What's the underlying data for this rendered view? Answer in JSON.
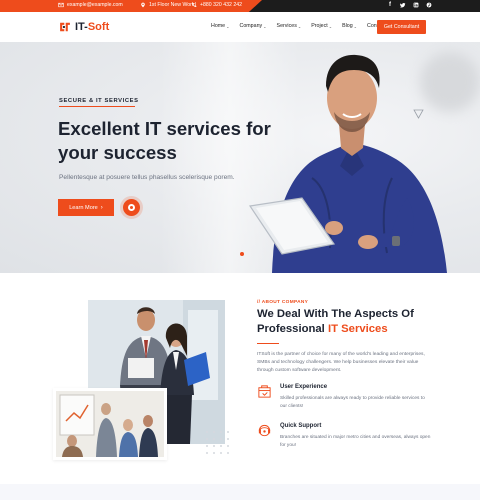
{
  "topbar": {
    "email": "example@example.com",
    "address": "1st Floor New World",
    "phone": "+880 320 432 242",
    "social_icons": [
      "facebook-icon",
      "twitter-icon",
      "linkedin-icon",
      "pinterest-icon"
    ]
  },
  "brand": {
    "name_prefix": "IT-",
    "name_suffix": "Soft"
  },
  "nav": {
    "items": [
      {
        "label": "Home",
        "dropdown": true
      },
      {
        "label": "Company",
        "dropdown": true
      },
      {
        "label": "Services",
        "dropdown": true
      },
      {
        "label": "Project",
        "dropdown": true
      },
      {
        "label": "Blog",
        "dropdown": true
      },
      {
        "label": "Contact",
        "dropdown": false
      }
    ],
    "cta_label": "Get Consultant"
  },
  "hero": {
    "eyebrow": "SECURE & IT SERVICES",
    "title": "Excellent IT services for your success",
    "subtitle": "Pellentesque at posuere tellus phasellus scelerisque porem.",
    "button_label": "Learn More",
    "button_icon": "chevron-right-icon"
  },
  "about": {
    "label": "// ABOUT COMPANY",
    "title_line1": "We Deal With The Aspects Of",
    "title_line2_prefix": "Professional ",
    "title_line2_accent": "IT Services",
    "text": "ITSoft is the partner of choice for many of the world's leading and enterprises, SMBs and technology challengers. We help businesses elevate their value through custom software development.",
    "features": [
      {
        "icon": "user-experience-icon",
        "title": "User Experience",
        "desc": "Skilled professionals are always ready to provide reliable services to our clients!"
      },
      {
        "icon": "support-icon",
        "title": "Quick Support",
        "desc": "Branches are situated in major metro cities and overseas, always open for you!"
      }
    ]
  },
  "colors": {
    "accent": "#ee4c1c",
    "dark": "#1d2330",
    "topbar": "#1c1c1c",
    "muted": "#6b7280"
  }
}
